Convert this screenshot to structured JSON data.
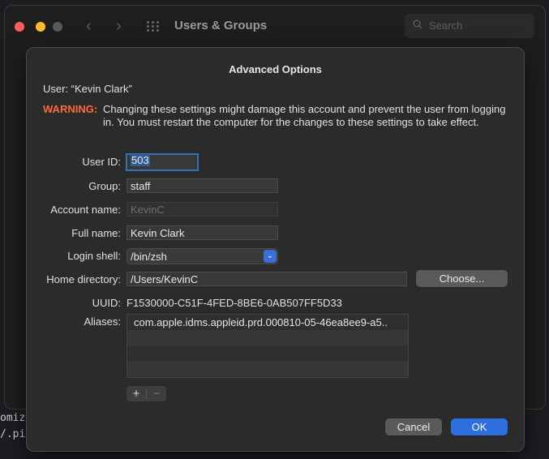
{
  "background": {
    "snippets": [
      "omiz",
      "/.pi"
    ]
  },
  "window": {
    "title": "Users & Groups",
    "search_placeholder": "Search"
  },
  "sheet": {
    "title": "Advanced Options",
    "user_line": "User:  “Kevin Clark”",
    "warning_label": "WARNING:",
    "warning_text": "Changing these settings might damage this account and prevent the user from logging in. You must restart the computer for the changes to these settings to take effect.",
    "labels": {
      "user_id": "User ID:",
      "group": "Group:",
      "account_name": "Account name:",
      "full_name": "Full name:",
      "login_shell": "Login shell:",
      "home_directory": "Home directory:",
      "uuid": "UUID:",
      "aliases": "Aliases:"
    },
    "values": {
      "user_id": "503",
      "group": "staff",
      "account_name": "KevinC",
      "full_name": "Kevin Clark",
      "login_shell": "/bin/zsh",
      "home_directory": "/Users/KevinC",
      "uuid": "F1530000-C51F-4FED-8BE6-0AB507FF5D33"
    },
    "aliases": [
      "com.apple.idms.appleid.prd.000810-05-46ea8ee9-a5..",
      "",
      "",
      ""
    ],
    "choose_label": "Choose...",
    "add_label": "+",
    "remove_label": "−",
    "cancel_label": "Cancel",
    "ok_label": "OK"
  },
  "colors": {
    "accent": "#2e6fe0",
    "warning": "#ff6a3d"
  }
}
